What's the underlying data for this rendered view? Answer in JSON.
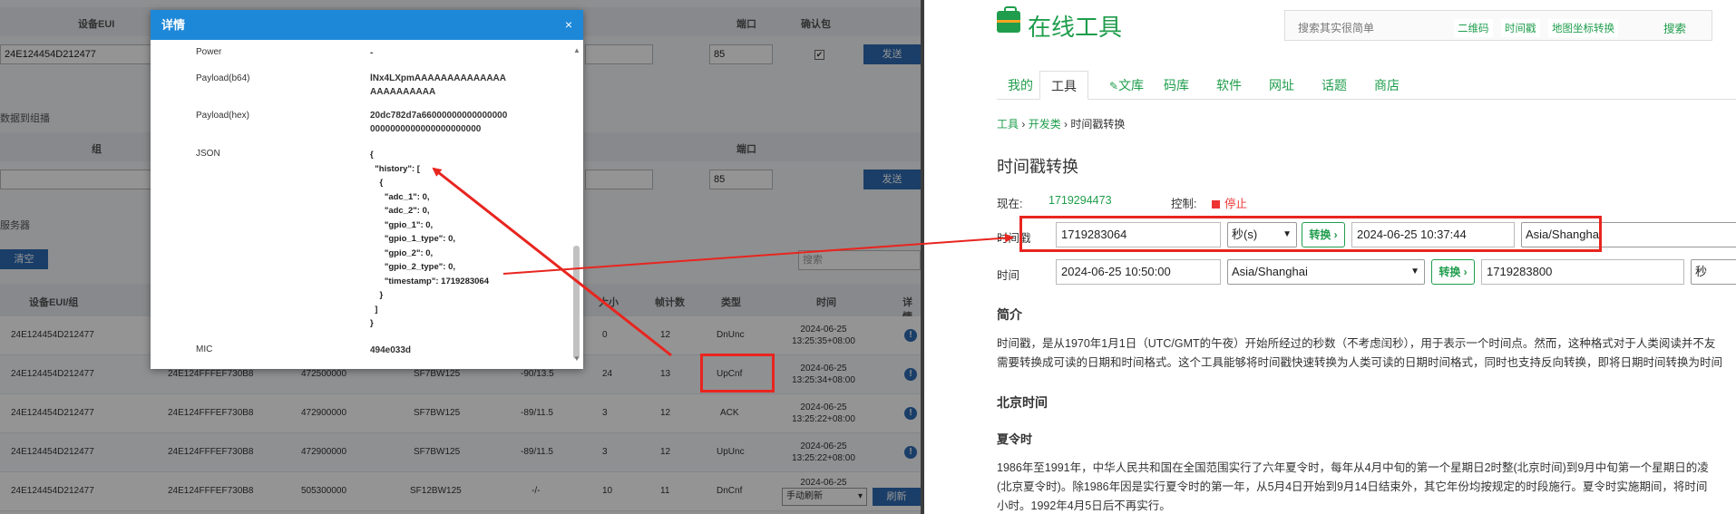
{
  "left": {
    "header1": {
      "eui": "设备EUI",
      "port": "端口",
      "confirm": "确认包"
    },
    "row1": {
      "eui": "24E124454D212477",
      "port": "85",
      "send": "发送"
    },
    "section_multicast": "数据到组播",
    "header2": {
      "group": "组",
      "port": "端口"
    },
    "row2": {
      "port": "85",
      "send": "发送"
    },
    "section_server": "服务器",
    "clear_button": "清空",
    "search_placeholder": "搜索",
    "table_headers": {
      "eui_group": "设备EUI/组",
      "size": "大小",
      "frame_count": "帧计数",
      "type": "类型",
      "time": "时间",
      "detail": "详情"
    },
    "rows": [
      {
        "eui": "24E124454D212477",
        "gw": "",
        "freq": "",
        "sf": "",
        "rssi": "",
        "size": "0",
        "fcnt": "12",
        "type": "DnUnc",
        "time": [
          "2024-06-25",
          "13:25:35+08:00"
        ]
      },
      {
        "eui": "24E124454D212477",
        "gw": "24E124FFFEF730B8",
        "freq": "472500000",
        "sf": "SF7BW125",
        "rssi": "-90/13.5",
        "size": "24",
        "fcnt": "13",
        "type": "UpCnf",
        "time": [
          "2024-06-25",
          "13:25:34+08:00"
        ]
      },
      {
        "eui": "24E124454D212477",
        "gw": "24E124FFFEF730B8",
        "freq": "472900000",
        "sf": "SF7BW125",
        "rssi": "-89/11.5",
        "size": "3",
        "fcnt": "12",
        "type": "ACK",
        "time": [
          "2024-06-25",
          "13:25:22+08:00"
        ]
      },
      {
        "eui": "24E124454D212477",
        "gw": "24E124FFFEF730B8",
        "freq": "472900000",
        "sf": "SF7BW125",
        "rssi": "-89/11.5",
        "size": "3",
        "fcnt": "12",
        "type": "UpUnc",
        "time": [
          "2024-06-25",
          "13:25:22+08:00"
        ]
      },
      {
        "eui": "24E124454D212477",
        "gw": "24E124FFFEF730B8",
        "freq": "505300000",
        "sf": "SF12BW125",
        "rssi": "-/-",
        "size": "10",
        "fcnt": "11",
        "type": "DnCnf",
        "time": [
          "2024-06-25",
          ""
        ]
      }
    ],
    "refresh_select": "手动刷新",
    "refresh_button": "刷新"
  },
  "modal": {
    "title": "详情",
    "close": "×",
    "power_key": "Power",
    "power_val": "-",
    "b64_key": "Payload(b64)",
    "b64_val1": "lNx4LXpmAAAAAAAAAAAAAA",
    "b64_val2": "AAAAAAAAAA",
    "hex_key": "Payload(hex)",
    "hex_val1": "20dc782d7a66000000000000000",
    "hex_val2": "0000000000000000000000",
    "json_key": "JSON",
    "json_val": "{\n  \"history\": [\n    {\n      \"adc_1\": 0,\n      \"adc_2\": 0,\n      \"gpio_1\": 0,\n      \"gpio_1_type\": 0,\n      \"gpio_2\": 0,\n      \"gpio_2_type\": 0,\n      \"timestamp\": 1719283064\n    }\n  ]\n}",
    "mic_key": "MIC",
    "mic_val": "494e033d"
  },
  "right": {
    "site_title": "在线工具",
    "search_placeholder": "搜索其实很简单",
    "quick_links": [
      "二维码",
      "时间戳",
      "地图坐标转换"
    ],
    "search_button": "搜索",
    "tabs": [
      "我的",
      "工具",
      "文库",
      "码库",
      "软件",
      "网址",
      "话题",
      "商店"
    ],
    "breadcrumb": {
      "home": "工具",
      "sep": " › ",
      "cat": "开发类",
      "current": "时间戳转换"
    },
    "page_title": "时间戳转换",
    "now_label": "现在:",
    "now_value": "1719294473",
    "control_label": "控制:",
    "stop_label": "停止",
    "row1": {
      "label": "时间戳",
      "input": "1719283064",
      "unit": "秒(s)",
      "btn": "转换 ›",
      "output": "2024-06-25 10:37:44",
      "tz": "Asia/Shanghai"
    },
    "row2": {
      "label": "时间",
      "input": "2024-06-25 10:50:00",
      "tz": "Asia/Shanghai",
      "btn": "转换 ›",
      "output": "1719283800",
      "unit": "秒"
    },
    "intro_heading": "简介",
    "intro_line1": "时间戳，是从1970年1月1日（UTC/GMT的午夜）开始所经过的秒数（不考虑闰秒），用于表示一个时间点。然而，这种格式对于人类阅读并不友",
    "intro_line2": "需要转换成可读的日期和时间格式。这个工具能够将时间戳快速转换为人类可读的日期时间格式，同时也支持反向转换，即将日期时间转换为时间",
    "beijing_heading": "北京时间",
    "dst_heading": "夏令时",
    "dst_line1": "1986年至1991年，中华人民共和国在全国范围实行了六年夏令时，每年从4月中旬的第一个星期日2时整(北京时间)到9月中旬第一个星期日的凌",
    "dst_line2": "(北京夏令时)。除1986年因是实行夏令时的第一年，从5月4日开始到9月14日结束外，其它年份均按规定的时段施行。夏令时实施期间，将时间",
    "dst_line3": "小时。1992年4月5日后不再实行。"
  },
  "colors": {
    "accent_green": "#1f9d4c",
    "annotation_red": "#e8251f",
    "modal_blue": "#1e88d8"
  }
}
